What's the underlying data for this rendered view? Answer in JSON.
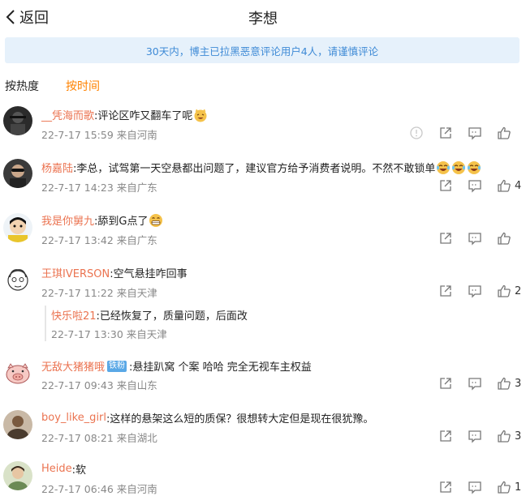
{
  "header": {
    "back_label": "返回",
    "title": "李想"
  },
  "notice": "30天内，博主已拉黑恶意评论用户4人，请谨慎评论",
  "sort": {
    "hot": "按热度",
    "time": "按时间"
  },
  "colors": {
    "accent": "#ff8200",
    "username": "#eb7350",
    "notice_bg": "#e6f1fb",
    "notice_text": "#3e8ad6"
  },
  "comments": [
    {
      "user": "__凭海而歌",
      "text": ":评论区咋又翻车了呢",
      "emoji": "cat-laugh-emoji",
      "time": "22-7-17 15:59 来自河南",
      "likes": "",
      "has_report": true
    },
    {
      "user": "杨嘉陆",
      "text": ":李总，试驾第一天空悬都出问题了，建议官方给予消费者说明。不然不敢锁单",
      "emoji": "laugh-cry-emoji-x3",
      "time": "22-7-17 14:23 来自广东",
      "likes": "4"
    },
    {
      "user": "我是你舅九",
      "text": ":舔到G点了",
      "emoji": "grin-emoji",
      "time": "22-7-17 13:42 来自广东",
      "likes": ""
    },
    {
      "user": "王琪IVERSON",
      "text": ":空气悬挂咋回事",
      "time": "22-7-17 11:22 来自天津",
      "likes": "2",
      "reply": {
        "user": "快乐啦21",
        "text": ":已经恢复了，质量问题，后面改",
        "time": "22-7-17 13:30 来自天津"
      }
    },
    {
      "user": "无敌大猪猪哦",
      "badge": "铁粉",
      "text": ":悬挂趴窝  个案 哈哈 完全无视车主权益",
      "time": "22-7-17 09:43 来自山东",
      "likes": "3"
    },
    {
      "user": "boy_like_girl",
      "text": ":这样的悬架这么短的质保？很想转大定但是现在很犹豫。",
      "time": "22-7-17 08:21 来自湖北",
      "likes": "3"
    },
    {
      "user": "Heide",
      "text": ":软",
      "time": "22-7-17 06:46 来自河南",
      "likes": "1"
    }
  ]
}
